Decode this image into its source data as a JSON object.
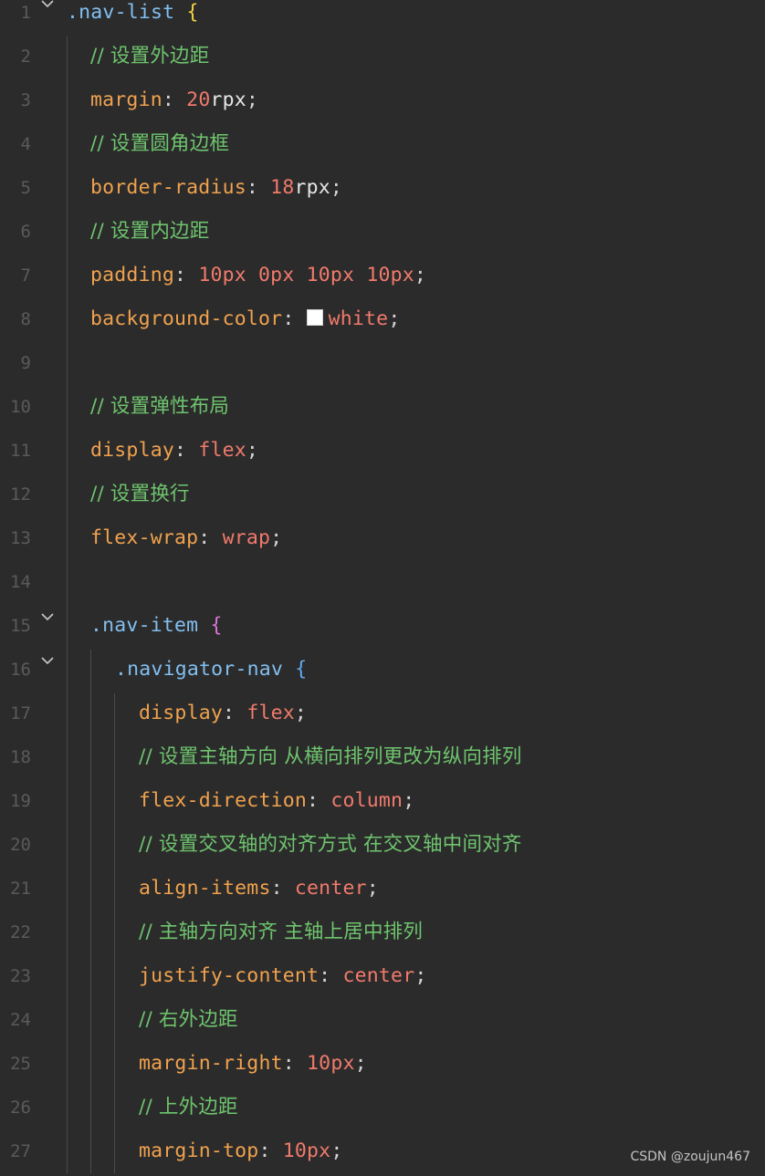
{
  "editor": {
    "lines": [
      {
        "n": "1",
        "tokens": [
          [
            ".nav-list",
            "sel"
          ],
          [
            " ",
            "punc"
          ],
          [
            "{",
            "brace-y"
          ]
        ]
      },
      {
        "n": "2",
        "tokens": [
          [
            "// 设置外边距",
            "cmt"
          ]
        ]
      },
      {
        "n": "3",
        "tokens": [
          [
            "margin",
            "prop"
          ],
          [
            ": ",
            "punc"
          ],
          [
            "20",
            "num"
          ],
          [
            "rpx",
            "unit"
          ],
          [
            ";",
            "punc"
          ]
        ]
      },
      {
        "n": "4",
        "tokens": [
          [
            "// 设置圆角边框",
            "cmt"
          ]
        ]
      },
      {
        "n": "5",
        "tokens": [
          [
            "border-radius",
            "prop"
          ],
          [
            ": ",
            "punc"
          ],
          [
            "18",
            "num"
          ],
          [
            "rpx",
            "unit"
          ],
          [
            ";",
            "punc"
          ]
        ]
      },
      {
        "n": "6",
        "tokens": [
          [
            "// 设置内边距",
            "cmt"
          ]
        ]
      },
      {
        "n": "7",
        "tokens": [
          [
            "padding",
            "prop"
          ],
          [
            ": ",
            "punc"
          ],
          [
            "10px 0px 10px 10px",
            "num"
          ],
          [
            ";",
            "punc"
          ]
        ]
      },
      {
        "n": "8",
        "tokens": [
          [
            "background-color",
            "prop"
          ],
          [
            ": ",
            "punc"
          ],
          [
            "",
            "swatch"
          ],
          [
            "white",
            "val"
          ],
          [
            ";",
            "punc"
          ]
        ]
      },
      {
        "n": "9",
        "tokens": []
      },
      {
        "n": "10",
        "tokens": [
          [
            "// 设置弹性布局",
            "cmt"
          ]
        ]
      },
      {
        "n": "11",
        "tokens": [
          [
            "display",
            "prop"
          ],
          [
            ": ",
            "punc"
          ],
          [
            "flex",
            "val"
          ],
          [
            ";",
            "punc"
          ]
        ]
      },
      {
        "n": "12",
        "tokens": [
          [
            "// 设置换行",
            "cmt"
          ]
        ]
      },
      {
        "n": "13",
        "tokens": [
          [
            "flex-wrap",
            "prop"
          ],
          [
            ": ",
            "punc"
          ],
          [
            "wrap",
            "val"
          ],
          [
            ";",
            "punc"
          ]
        ]
      },
      {
        "n": "14",
        "tokens": []
      },
      {
        "n": "15",
        "tokens": [
          [
            ".nav-item",
            "sel"
          ],
          [
            " ",
            "punc"
          ],
          [
            "{",
            "brace-p"
          ]
        ]
      },
      {
        "n": "16",
        "tokens": [
          [
            ".navigator-nav",
            "sel"
          ],
          [
            " ",
            "punc"
          ],
          [
            "{",
            "brace-b"
          ]
        ]
      },
      {
        "n": "17",
        "tokens": [
          [
            "display",
            "prop"
          ],
          [
            ": ",
            "punc"
          ],
          [
            "flex",
            "val"
          ],
          [
            ";",
            "punc"
          ]
        ]
      },
      {
        "n": "18",
        "tokens": [
          [
            "// 设置主轴方向 从横向排列更改为纵向排列",
            "cmt"
          ]
        ]
      },
      {
        "n": "19",
        "tokens": [
          [
            "flex-direction",
            "prop"
          ],
          [
            ": ",
            "punc"
          ],
          [
            "column",
            "val"
          ],
          [
            ";",
            "punc"
          ]
        ]
      },
      {
        "n": "20",
        "tokens": [
          [
            "// 设置交叉轴的对齐方式 在交叉轴中间对齐",
            "cmt"
          ]
        ]
      },
      {
        "n": "21",
        "tokens": [
          [
            "align-items",
            "prop"
          ],
          [
            ": ",
            "punc"
          ],
          [
            "center",
            "val"
          ],
          [
            ";",
            "punc"
          ]
        ]
      },
      {
        "n": "22",
        "tokens": [
          [
            "// 主轴方向对齐 主轴上居中排列",
            "cmt"
          ]
        ]
      },
      {
        "n": "23",
        "tokens": [
          [
            "justify-content",
            "prop"
          ],
          [
            ": ",
            "punc"
          ],
          [
            "center",
            "val"
          ],
          [
            ";",
            "punc"
          ]
        ]
      },
      {
        "n": "24",
        "tokens": [
          [
            "// 右外边距",
            "cmt"
          ]
        ]
      },
      {
        "n": "25",
        "tokens": [
          [
            "margin-right",
            "prop"
          ],
          [
            ": ",
            "punc"
          ],
          [
            "10px",
            "num"
          ],
          [
            ";",
            "punc"
          ]
        ]
      },
      {
        "n": "26",
        "tokens": [
          [
            "// 上外边距",
            "cmt"
          ]
        ]
      },
      {
        "n": "27",
        "tokens": [
          [
            "margin-top",
            "prop"
          ],
          [
            ": ",
            "punc"
          ],
          [
            "10px",
            "num"
          ],
          [
            ";",
            "punc"
          ]
        ]
      }
    ]
  },
  "watermark": "CSDN @zoujun467"
}
